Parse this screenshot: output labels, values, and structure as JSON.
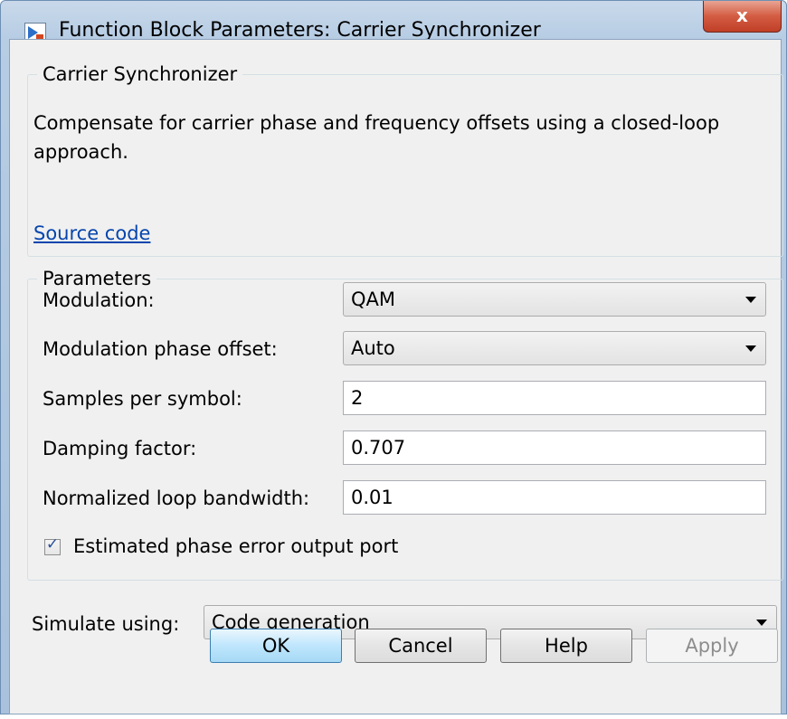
{
  "window": {
    "title": "Function Block Parameters: Carrier Synchronizer",
    "close_label": "x"
  },
  "description_group": {
    "legend": "Carrier Synchronizer",
    "text": "Compensate for carrier phase and frequency offsets using a closed-loop approach.",
    "link": "Source code"
  },
  "parameters": {
    "legend": "Parameters",
    "modulation": {
      "label": "Modulation:",
      "value": "QAM"
    },
    "phase_offset": {
      "label": "Modulation phase offset:",
      "value": "Auto"
    },
    "samples_per_symbol": {
      "label": "Samples per symbol:",
      "value": "2"
    },
    "damping_factor": {
      "label": "Damping factor:",
      "value": "0.707"
    },
    "loop_bandwidth": {
      "label": "Normalized loop bandwidth:",
      "value": "0.01"
    },
    "phase_error_port": {
      "label": "Estimated phase error output port",
      "checked": true
    }
  },
  "simulate": {
    "label": "Simulate using:",
    "value": "Code generation"
  },
  "buttons": {
    "ok": "OK",
    "cancel": "Cancel",
    "help": "Help",
    "apply": "Apply"
  }
}
